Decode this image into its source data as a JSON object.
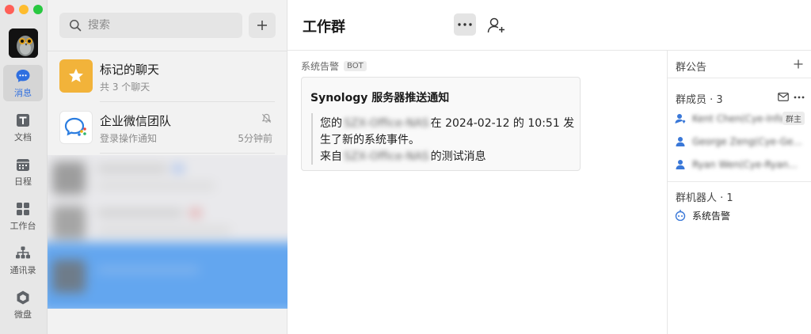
{
  "colors": {
    "accent": "#2f6fe0",
    "starred": "#f2b33a",
    "traffic_red": "#ff5f57",
    "traffic_yellow": "#febc2e",
    "traffic_green": "#28c840"
  },
  "rail": {
    "items": [
      {
        "label": "消息",
        "icon": "message-icon",
        "active": true
      },
      {
        "label": "文档",
        "icon": "document-icon",
        "active": false
      },
      {
        "label": "日程",
        "icon": "calendar-icon",
        "active": false
      },
      {
        "label": "工作台",
        "icon": "workbench-icon",
        "active": false
      },
      {
        "label": "通讯录",
        "icon": "contacts-icon",
        "active": false
      },
      {
        "label": "微盘",
        "icon": "drive-icon",
        "active": false
      }
    ]
  },
  "search": {
    "placeholder": "搜索"
  },
  "chats": [
    {
      "name": "标记的聊天",
      "subtitle": "共 3 个聊天",
      "icon": "star-icon"
    },
    {
      "name": "企业微信团队",
      "subtitle": "登录操作通知",
      "time": "5分钟前",
      "icon": "wecom-icon",
      "muted": true
    }
  ],
  "conversation": {
    "title": "工作群",
    "sender": "系统告警",
    "sender_badge": "BOT",
    "card": {
      "title": "Synology 服务器推送通知",
      "line1_prefix": "您的",
      "line1_suffix": "在 2024-02-12 的 10:51 发",
      "line2": "生了新的系统事件。",
      "line3_prefix": "来自",
      "line3_suffix": "的测试消息",
      "redacted_name": "SZX-Office-NAS"
    }
  },
  "panel": {
    "announcement": "群公告",
    "members_title": "群成员 · 3",
    "members": [
      {
        "name": "Kent Chen(Cye-Infor...",
        "badge": "群主"
      },
      {
        "name": "George Zeng(Cye-Ge...",
        "badge": ""
      },
      {
        "name": "Ryan Wen(Cye-Ryan...",
        "badge": ""
      }
    ],
    "robots_title": "群机器人 · 1",
    "robot": "系统告警"
  }
}
